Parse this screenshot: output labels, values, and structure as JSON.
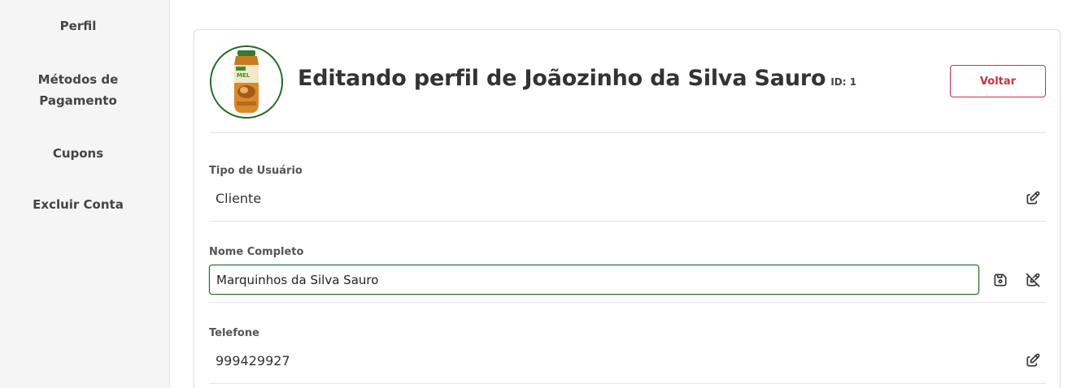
{
  "sidebar": {
    "items": [
      {
        "label": "Perfil"
      },
      {
        "label_line1": "Métodos de",
        "label_line2": "Pagamento"
      },
      {
        "label": "Cupons"
      },
      {
        "label": "Excluir Conta"
      }
    ]
  },
  "header": {
    "title": "Editando perfil de Joãozinho da Silva Sauro",
    "id_label": "ID: 1",
    "back_label": "Voltar",
    "avatar_product_text": "MEL"
  },
  "fields": {
    "user_type": {
      "label": "Tipo de Usuário",
      "value": "Cliente"
    },
    "full_name": {
      "label": "Nome Completo",
      "value": "Marquinhos da Silva Sauro"
    },
    "phone": {
      "label": "Telefone",
      "value": "999429927"
    }
  },
  "colors": {
    "accent_green": "#1e6b1e",
    "danger_red": "#c8323f",
    "sidebar_bg": "#f5f5f5"
  },
  "icons": {
    "edit": "edit-icon",
    "save": "save-icon",
    "cancel_edit": "edit-off-icon"
  }
}
